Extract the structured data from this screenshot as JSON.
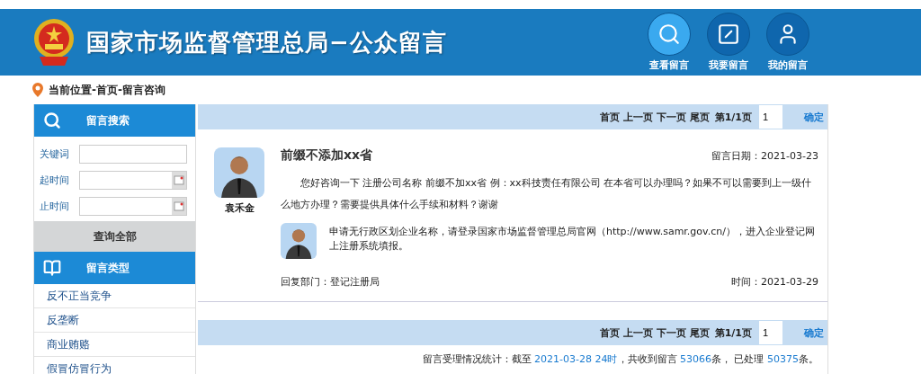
{
  "header": {
    "title": "国家市场监督管理总局−公众留言",
    "nav": [
      {
        "label": "查看留言",
        "selected": true
      },
      {
        "label": "我要留言",
        "selected": false
      },
      {
        "label": "我的留言",
        "selected": false
      }
    ]
  },
  "breadcrumb": "当前位置-首页-留言咨询",
  "sidebar": {
    "search_title": "留言搜索",
    "fields": [
      {
        "label": "关键词",
        "kind": "text"
      },
      {
        "label": "起时间",
        "kind": "date"
      },
      {
        "label": "止时间",
        "kind": "date"
      }
    ],
    "query_all": "查询全部",
    "types_title": "留言类型",
    "types": [
      "反不正当竞争",
      "反垄断",
      "商业贿赂",
      "假冒仿冒行为"
    ]
  },
  "pager_top": {
    "links": [
      "首页",
      "上一页",
      "下一页",
      "尾页"
    ],
    "status": "第1/1页",
    "page_value": "1",
    "confirm": "确定"
  },
  "post": {
    "author": "袁禾金",
    "title": "前缀不添加xx省",
    "date": "留言日期：2021-03-23",
    "body": "您好咨询一下 注册公司名称 前缀不加xx省 例：xx科技责任有限公司 在本省可以办理吗？如果不可以需要到上一级什么地方办理？需要提供具体什么手续和材料？谢谢",
    "reply": "申请无行政区划企业名称，请登录国家市场监督管理总局官网（http://www.samr.gov.cn/），进入企业登记网上注册系统填报。",
    "department": "回复部门：登记注册局",
    "reply_time": "时间：2021-03-29"
  },
  "pager_bottom": {
    "links": [
      "首页",
      "上一页",
      "下一页",
      "尾页"
    ],
    "status": "第1/1页",
    "page_value": "1",
    "confirm": "确定"
  },
  "stats": [
    {
      "kind": "text",
      "text": "留言受理情况统计：截至 "
    },
    {
      "kind": "value",
      "text": "2021-03-28 24时"
    },
    {
      "kind": "text",
      "text": "，共收到留言 "
    },
    {
      "kind": "value",
      "text": "53066"
    },
    {
      "kind": "text",
      "text": "条， 已处理 "
    },
    {
      "kind": "value",
      "text": "50375"
    },
    {
      "kind": "text",
      "text": "条。"
    }
  ]
}
